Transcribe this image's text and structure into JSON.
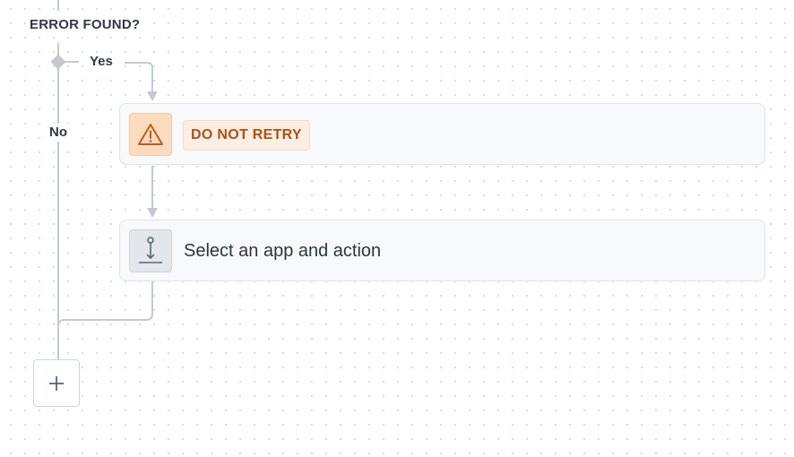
{
  "condition": {
    "label": "ERROR FOUND?"
  },
  "branches": {
    "yes_label": "Yes",
    "no_label": "No"
  },
  "steps": [
    {
      "icon": "warning-icon",
      "badge": "DO NOT RETRY",
      "icon_background": "#fcdcc0",
      "icon_color": "#c2581b",
      "badge_text_color": "#b14f14"
    },
    {
      "icon": "placeholder-app-icon",
      "title": "Select an app and action",
      "icon_background": "#e3e7eb"
    }
  ],
  "add_step": {
    "icon": "plus-icon"
  },
  "colors": {
    "connector": "#c3c9cf",
    "card_background": "#f8f9fa",
    "card_border": "#dfe3e7",
    "text": "#2b3540"
  }
}
